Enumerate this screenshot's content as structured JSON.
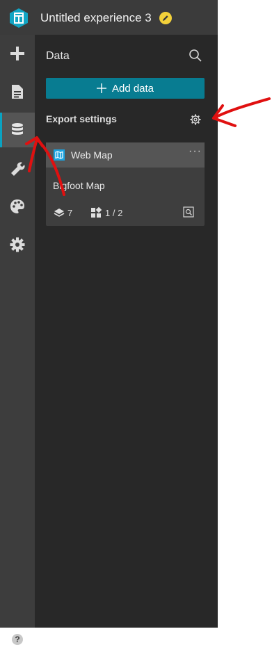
{
  "header": {
    "title": "Untitled experience 3",
    "logo_icon": "experience-builder-logo-icon",
    "edit_icon": "pencil-icon",
    "accent_color": "#0aa3c2"
  },
  "nav": {
    "items": [
      {
        "name": "insert",
        "icon": "plus-icon"
      },
      {
        "name": "page",
        "icon": "document-icon"
      },
      {
        "name": "data",
        "icon": "database-icon",
        "active": true
      },
      {
        "name": "tools",
        "icon": "wrench-icon"
      },
      {
        "name": "theme",
        "icon": "palette-icon"
      },
      {
        "name": "settings",
        "icon": "gear-icon"
      }
    ],
    "help_label": "?"
  },
  "panel": {
    "title": "Data",
    "add_data_label": "Add data",
    "add_data_color": "#087c91",
    "export_settings_label": "Export settings",
    "card": {
      "type_label": "Web Map",
      "more_label": "···",
      "name": "Bigfoot Map",
      "layers_count": "7",
      "widgets_count": "1 / 2",
      "map_icon_color": "#1ba3e0"
    }
  },
  "annotations": {
    "color": "#e01010",
    "arrows": [
      "arrow-to-data-tab",
      "arrow-to-export-gear"
    ]
  }
}
